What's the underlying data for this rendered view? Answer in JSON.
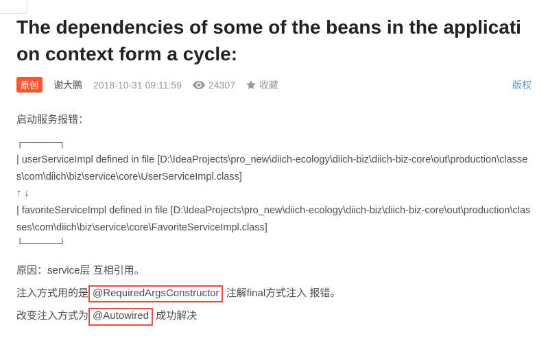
{
  "title": "The dependencies of some of the beans in the application context form a cycle:",
  "meta": {
    "badge": "原创",
    "author": "谢大鹏",
    "datetime": "2018-10-31 09:11:59",
    "views": "24307",
    "collect": "收藏",
    "copyright": "版权"
  },
  "body": {
    "intro": "启动服务报错：",
    "ascii_top": "┌─────┐",
    "err1": "|  userServiceImpl defined in file [D:\\IdeaProjects\\pro_new\\diich-ecology\\diich-biz\\diich-biz-core\\out\\production\\classes\\com\\diich\\biz\\service\\core\\UserServiceImpl.class]",
    "ascii_mid": "↑     ↓",
    "err2": "|  favoriteServiceImpl defined in file [D:\\IdeaProjects\\pro_new\\diich-ecology\\diich-biz\\diich-biz-core\\out\\production\\classes\\com\\diich\\biz\\service\\core\\FavoriteServiceImpl.class]",
    "ascii_bottom": "└─────┘",
    "reason": "原因：service层 互相引用。",
    "inject_pre": "注入方式用的是",
    "inject_box1": "@RequiredArgsConstructor",
    "inject_post": " 注解final方式注入 报错。",
    "fix_pre": "改变注入方式为",
    "fix_box": "@Autowired",
    "fix_post": " 成功解决"
  }
}
